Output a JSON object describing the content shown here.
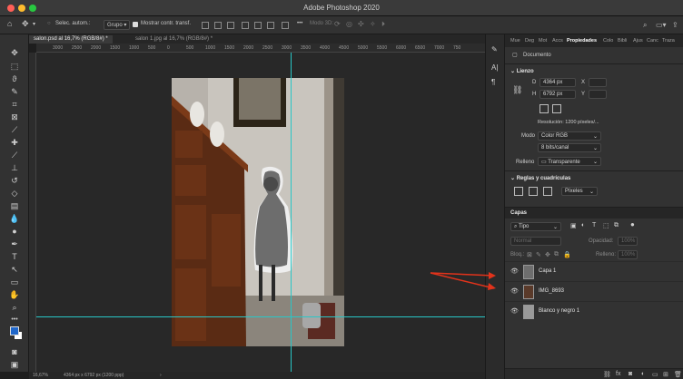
{
  "window": {
    "title": "Adobe Photoshop 2020"
  },
  "options_bar": {
    "auto_select_label": "Selec. autom.:",
    "auto_select_value": "Grupo",
    "show_transform_label": "Mostrar contr. transf.",
    "mode_3d_label": "Modo 3D:"
  },
  "tabs": [
    {
      "label": "salon.psd al 16,7% (RGB/8#) *",
      "active": true
    },
    {
      "label": "salon 1.jpg al 16,7% (RGB/8#) *",
      "active": false
    }
  ],
  "ruler_ticks": [
    "3000",
    "2500",
    "2000",
    "1500",
    "1000",
    "500",
    "0",
    "500",
    "1000",
    "1500",
    "2000",
    "2500",
    "3000",
    "3500",
    "4000",
    "4500",
    "5000",
    "5500",
    "6000",
    "6500",
    "7000",
    "750"
  ],
  "status_bar": {
    "zoom": "16,67%",
    "doc_size": "4364 px x 6792 px (1200 ppp)"
  },
  "right_panel": {
    "tabs": [
      "Mue",
      "Deg",
      "Mot",
      "Accs",
      "Propiedades",
      "Colo",
      "Bibli",
      "Ajus",
      "Canc",
      "Traza"
    ],
    "active_tab": "Propiedades",
    "document_label": "Documento",
    "canvas_section": "Lienzo",
    "width_label": "D",
    "width_value": "4364 px",
    "x_label": "X",
    "height_label": "H",
    "height_value": "6792 px",
    "y_label": "Y",
    "resolution": "Resolución: 1200 píxeles/...",
    "mode_label": "Modo",
    "mode_value": "Color RGB",
    "bit_depth": "8 bits/canal",
    "fill_label": "Relleno",
    "fill_value": "Transparente",
    "rulers_section": "Reglas y cuadrículas",
    "units_value": "Píxeles"
  },
  "layers_panel": {
    "title": "Capas",
    "filter_value": "Tipo",
    "blend_mode": "Normal",
    "opacity_label": "Opacidad:",
    "opacity_value": "100%",
    "lock_label": "Bloq.:",
    "fill_label": "Relleno:",
    "fill_value": "100%",
    "layers": [
      {
        "name": "Capa 1"
      },
      {
        "name": "IMG_8693"
      },
      {
        "name": "Blanco y negro 1"
      }
    ]
  },
  "colors": {
    "guide": "#28c7c7",
    "annotation_arrow": "#e2331b",
    "foreground": "#1f66c9",
    "background": "#ffffff"
  }
}
